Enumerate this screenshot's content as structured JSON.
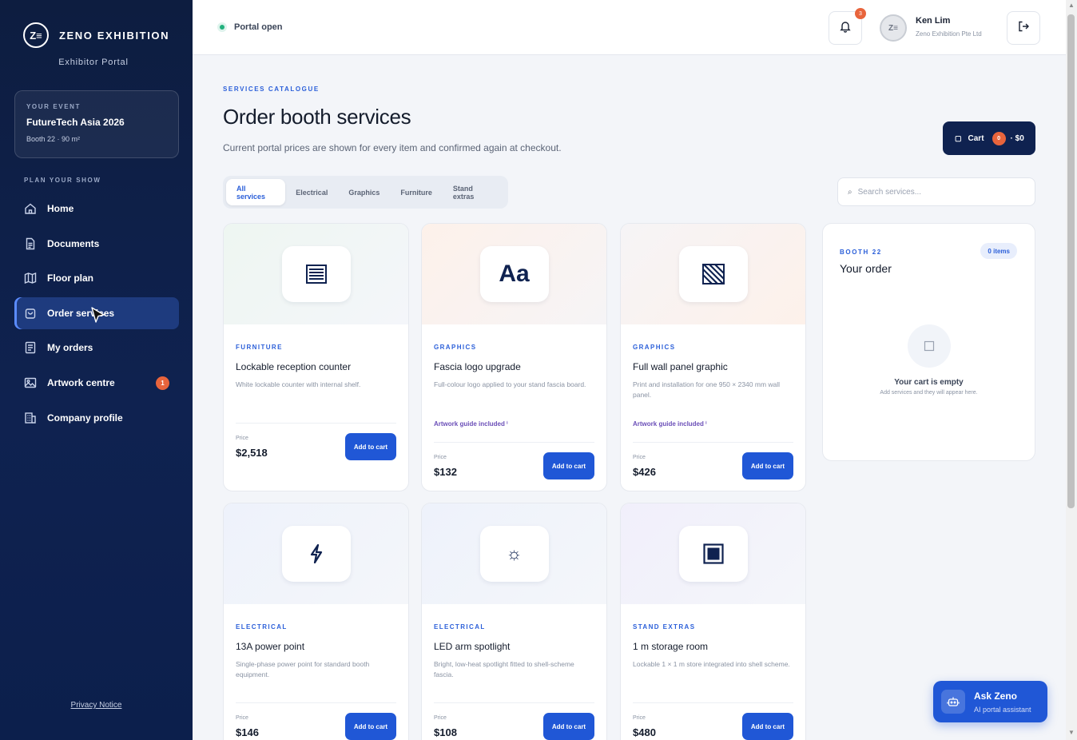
{
  "brand": {
    "logo_text": "Z≡",
    "name": "ZENO EXHIBITION",
    "subtitle": "Exhibitor Portal"
  },
  "event": {
    "label": "YOUR EVENT",
    "name": "FutureTech Asia 2026",
    "meta": "Booth 22 · 90 m²"
  },
  "nav": {
    "section_label": "PLAN YOUR SHOW",
    "items": [
      {
        "label": "Home",
        "icon": "home-icon"
      },
      {
        "label": "Documents",
        "icon": "document-icon"
      },
      {
        "label": "Floor plan",
        "icon": "map-icon"
      },
      {
        "label": "Order services",
        "icon": "bag-icon",
        "active": true
      },
      {
        "label": "My orders",
        "icon": "list-icon"
      },
      {
        "label": "Artwork centre",
        "icon": "image-icon",
        "badge": "1"
      },
      {
        "label": "Company profile",
        "icon": "building-icon"
      }
    ],
    "privacy": "Privacy Notice"
  },
  "topbar": {
    "status": "Portal open",
    "notifications": "3",
    "user": {
      "avatar": "Z≡",
      "name": "Ken Lim",
      "company": "Zeno Exhibition Pte Ltd"
    }
  },
  "header": {
    "kicker": "SERVICES CATALOGUE",
    "title": "Order booth services",
    "subtitle": "Current portal prices are shown for every item and confirmed again at checkout."
  },
  "cart": {
    "label": "Cart",
    "count": "0",
    "total": "· $0",
    "icon": "cart-icon"
  },
  "tabs": [
    "All services",
    "Electrical",
    "Graphics",
    "Furniture",
    "Stand extras"
  ],
  "search": {
    "placeholder": "Search services..."
  },
  "products": [
    {
      "category": "FURNITURE",
      "name": "Lockable reception counter",
      "desc": "White lockable counter with internal shelf.",
      "guide": "",
      "price_label": "Price",
      "price": "$2,518",
      "button": "Add to cart",
      "icon": "counter-icon"
    },
    {
      "category": "GRAPHICS",
      "name": "Fascia logo upgrade",
      "desc": "Full-colour logo applied to your stand fascia board.",
      "guide": "Artwork guide included",
      "price_label": "Price",
      "price": "$132",
      "button": "Add to cart",
      "icon": "text-aa-icon",
      "icon_text": "Aa"
    },
    {
      "category": "GRAPHICS",
      "name": "Full wall panel graphic",
      "desc": "Print and installation for one 950 × 2340 mm wall panel.",
      "guide": "Artwork guide included",
      "price_label": "Price",
      "price": "$426",
      "button": "Add to cart",
      "icon": "striped-panel-icon"
    },
    {
      "category": "ELECTRICAL",
      "name": "13A power point",
      "desc": "Single-phase power point for standard booth equipment.",
      "guide": "",
      "price_label": "Price",
      "price": "$146",
      "button": "Add to cart",
      "icon": "lightning-icon"
    },
    {
      "category": "ELECTRICAL",
      "name": "LED arm spotlight",
      "desc": "Bright, low-heat spotlight fitted to shell-scheme fascia.",
      "guide": "",
      "price_label": "Price",
      "price": "$108",
      "button": "Add to cart",
      "icon": "sun-icon"
    },
    {
      "category": "STAND EXTRAS",
      "name": "1 m storage room",
      "desc": "Lockable 1 × 1 m store integrated into shell scheme.",
      "guide": "",
      "price_label": "Price",
      "price": "$480",
      "button": "Add to cart",
      "icon": "square-icon"
    }
  ],
  "order": {
    "kicker": "BOOTH 22",
    "title": "Your order",
    "items_badge": "0 items",
    "empty_title": "Your cart is empty",
    "empty_sub": "Add services and they will appear here."
  },
  "assistant": {
    "title": "Ask Zeno",
    "subtitle": "AI portal assistant",
    "icon": "robot-icon"
  },
  "colors": {
    "sidebar": "#0f2250",
    "accent": "#2057d6",
    "badge": "#e8643c",
    "status_ok": "#22b07d"
  }
}
